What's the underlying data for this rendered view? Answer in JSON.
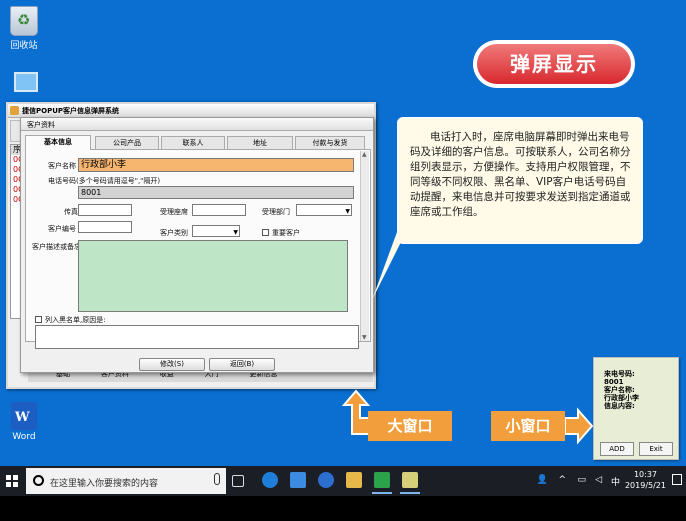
{
  "desktop": {
    "recycle_label": "回收站",
    "word_label": "Word",
    "word_glyph": "W"
  },
  "main_window": {
    "title": "捷信POPUP客户信息弹屏系统",
    "table_header": "序",
    "table_rows": [
      "0C",
      "0C",
      "0C",
      "0C",
      "0C"
    ],
    "bg_tabs": [
      "基础",
      "客户资料",
      "收益",
      "大门",
      "更新信息"
    ]
  },
  "dialog": {
    "title": "客户资料",
    "tabs": [
      "基本信息",
      "公司产品",
      "联系人",
      "地址",
      "付款与发货"
    ],
    "labels": {
      "name": "客户名称",
      "phone": "电话号码(多个号码请用逗号\",\"隔开)",
      "fax": "传真",
      "manager": "受理座席",
      "dept": "受理部门",
      "code": "客户编号",
      "category": "客户类别",
      "important": "重要客户",
      "remark": "客户描述或备忘",
      "blacklist": "列入黑名单,原因是:"
    },
    "values": {
      "name": "行政部小李",
      "phone": "8001"
    },
    "buttons": {
      "modify": "修改(S)",
      "back": "返回(B)"
    }
  },
  "banner": {
    "text": "弹屏显示"
  },
  "callout": {
    "text": "电话打入时，座席电脑屏幕即时弹出来电号码及详细的客户信息。可按联系人，公司名称分组列表显示，方便操作。支持用户权限管理，不同等级不同权限、黑名单、VIP客户电话号码自动提醒，来电信息并可按要求发送到指定通道或座席或工作组。"
  },
  "labels": {
    "big_window": "大窗口",
    "small_window": "小窗口"
  },
  "small_window": {
    "line1": "来电号码:",
    "line2": "8001",
    "line3": "客户名称:",
    "line4": "行政部小李",
    "line5": "信息内容:",
    "add": "ADD",
    "exit": "Exit"
  },
  "taskbar": {
    "search_placeholder": "在这里输入你要搜索的内容",
    "time": "10:37",
    "date": "2019/5/21",
    "ime": "中"
  },
  "colors": {
    "desktop": "#0a6fd0",
    "accent_orange": "#f29e3c",
    "banner_red": "#d8282e"
  }
}
